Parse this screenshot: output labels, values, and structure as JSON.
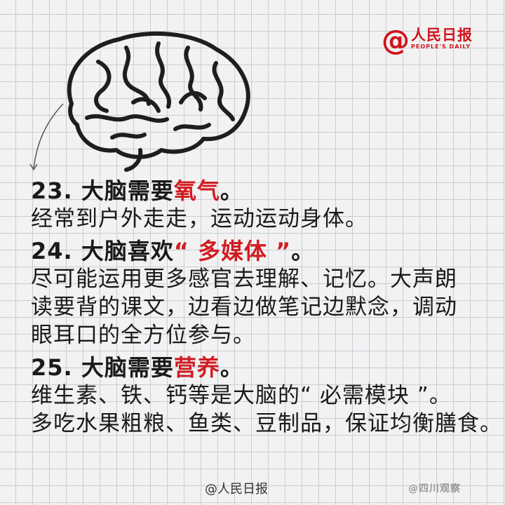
{
  "logo": {
    "at": "@",
    "name": "人民日报",
    "sub": "PEOPLE'S DAILY"
  },
  "sections": [
    {
      "number": "23.",
      "title_pre": "大脑需要",
      "title_hl": "氧气",
      "title_post": "。",
      "lines": [
        "经常到户外走走，运动运动身体。"
      ]
    },
    {
      "number": "24.",
      "title_pre": "大脑喜欢",
      "title_hl": "“ 多媒体 ”",
      "title_post": "。",
      "lines": [
        "尽可能运用更多感官去理解、记忆。大声朗",
        "读要背的课文，边看边做笔记边默念，调动",
        "眼耳口的全方位参与。"
      ]
    },
    {
      "number": "25.",
      "title_pre": "大脑需要",
      "title_hl": "营养",
      "title_post": "。",
      "lines": [
        "维生素、铁、钙等是大脑的“ 必需模块 ”。",
        "多吃水果粗粮、鱼类、豆制品，保证均衡膳食。"
      ]
    }
  ],
  "footer": "@人民日报",
  "watermark": "@四川观察"
}
